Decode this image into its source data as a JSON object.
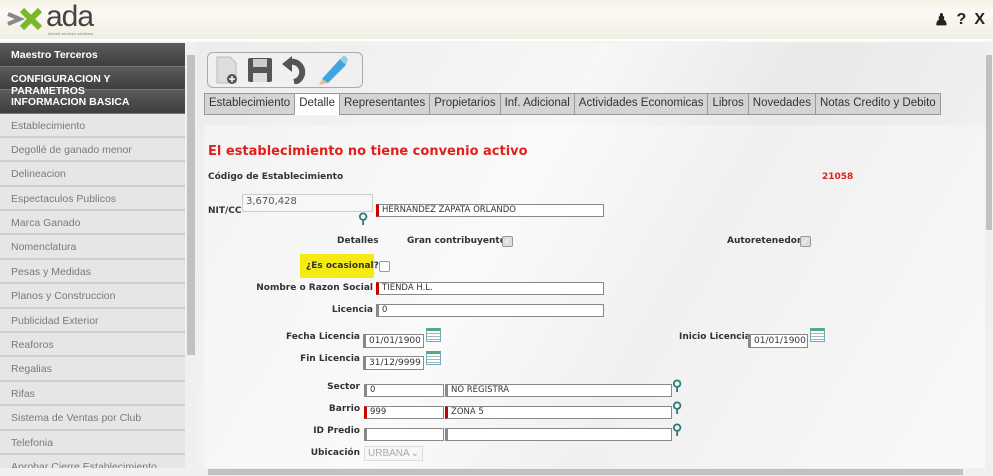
{
  "header": {
    "logo_text": "ada",
    "logo_tagline": "shared services solutions",
    "help_label": "?",
    "close_label": "X"
  },
  "sidebar": {
    "sections": [
      "Maestro Terceros",
      "CONFIGURACION Y PARAMETROS",
      "INFORMACION BASICA"
    ],
    "items": [
      "Establecimiento",
      "Degollé de ganado menor",
      "Delineacion",
      "Espectaculos Publicos",
      "Marca Ganado",
      "Nomenclatura",
      "Pesas y Medidas",
      "Planos y Construccion",
      "Publicidad Exterior",
      "Reaforos",
      "Regalias",
      "Rifas",
      "Sistema de Ventas por Club",
      "Telefonia",
      "Aprobar Cierre Establecimiento"
    ]
  },
  "tabs": [
    "Establecimiento",
    "Detalle",
    "Representantes",
    "Propietarios",
    "Inf. Adicional",
    "Actividades Economicas",
    "Libros",
    "Novedades",
    "Notas Credito y Debito"
  ],
  "active_tab": "Detalle",
  "form": {
    "alert": "El establecimiento no tiene convenio activo",
    "codigo_label": "Código de Establecimiento",
    "codigo_value": "21058",
    "nit_label": "NIT/CC",
    "nit_value": "3,670,428",
    "nit_name": "HERNANDEZ ZAPATA ORLANDO",
    "detalles_label": "Detalles",
    "gran_contribuyente_label": "Gran contribuyente",
    "autoretenedor_label": "Autoretenedor",
    "ocasional_label": "¿Es ocasional?",
    "nombre_label": "Nombre o Razon Social",
    "nombre_value": "TIENDA H.L.",
    "licencia_label": "Licencia",
    "licencia_value": "0",
    "fecha_licencia_label": "Fecha Licencia",
    "fecha_licencia_value": "01/01/1900",
    "inicio_licencia_label": "Inicio Licencia",
    "inicio_licencia_value": "01/01/1900",
    "fin_licencia_label": "Fin Licencia",
    "fin_licencia_value": "31/12/9999",
    "sector_label": "Sector",
    "sector_code": "0",
    "sector_name": "NO REGISTRA",
    "barrio_label": "Barrio",
    "barrio_code": "999",
    "barrio_name": "ZONA 5",
    "predio_label": "ID Predio",
    "predio_code": "",
    "predio_name": "",
    "ubicacion_label": "Ubicación",
    "ubicacion_value": "URBANA"
  }
}
